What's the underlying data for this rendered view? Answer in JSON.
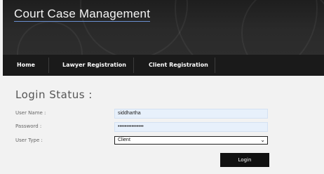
{
  "header": {
    "title": "Court Case Management"
  },
  "nav": {
    "items": [
      {
        "label": "Home"
      },
      {
        "label": "Lawyer Registration"
      },
      {
        "label": "Client Registration"
      }
    ]
  },
  "login": {
    "heading": "Login Status :",
    "username": {
      "label": "User Name :",
      "value": "siddhartha"
    },
    "password": {
      "label": "Password :",
      "value": "•••••••••••••••"
    },
    "usertype": {
      "label": "User Type :",
      "value": "Client"
    },
    "button": "Login"
  }
}
